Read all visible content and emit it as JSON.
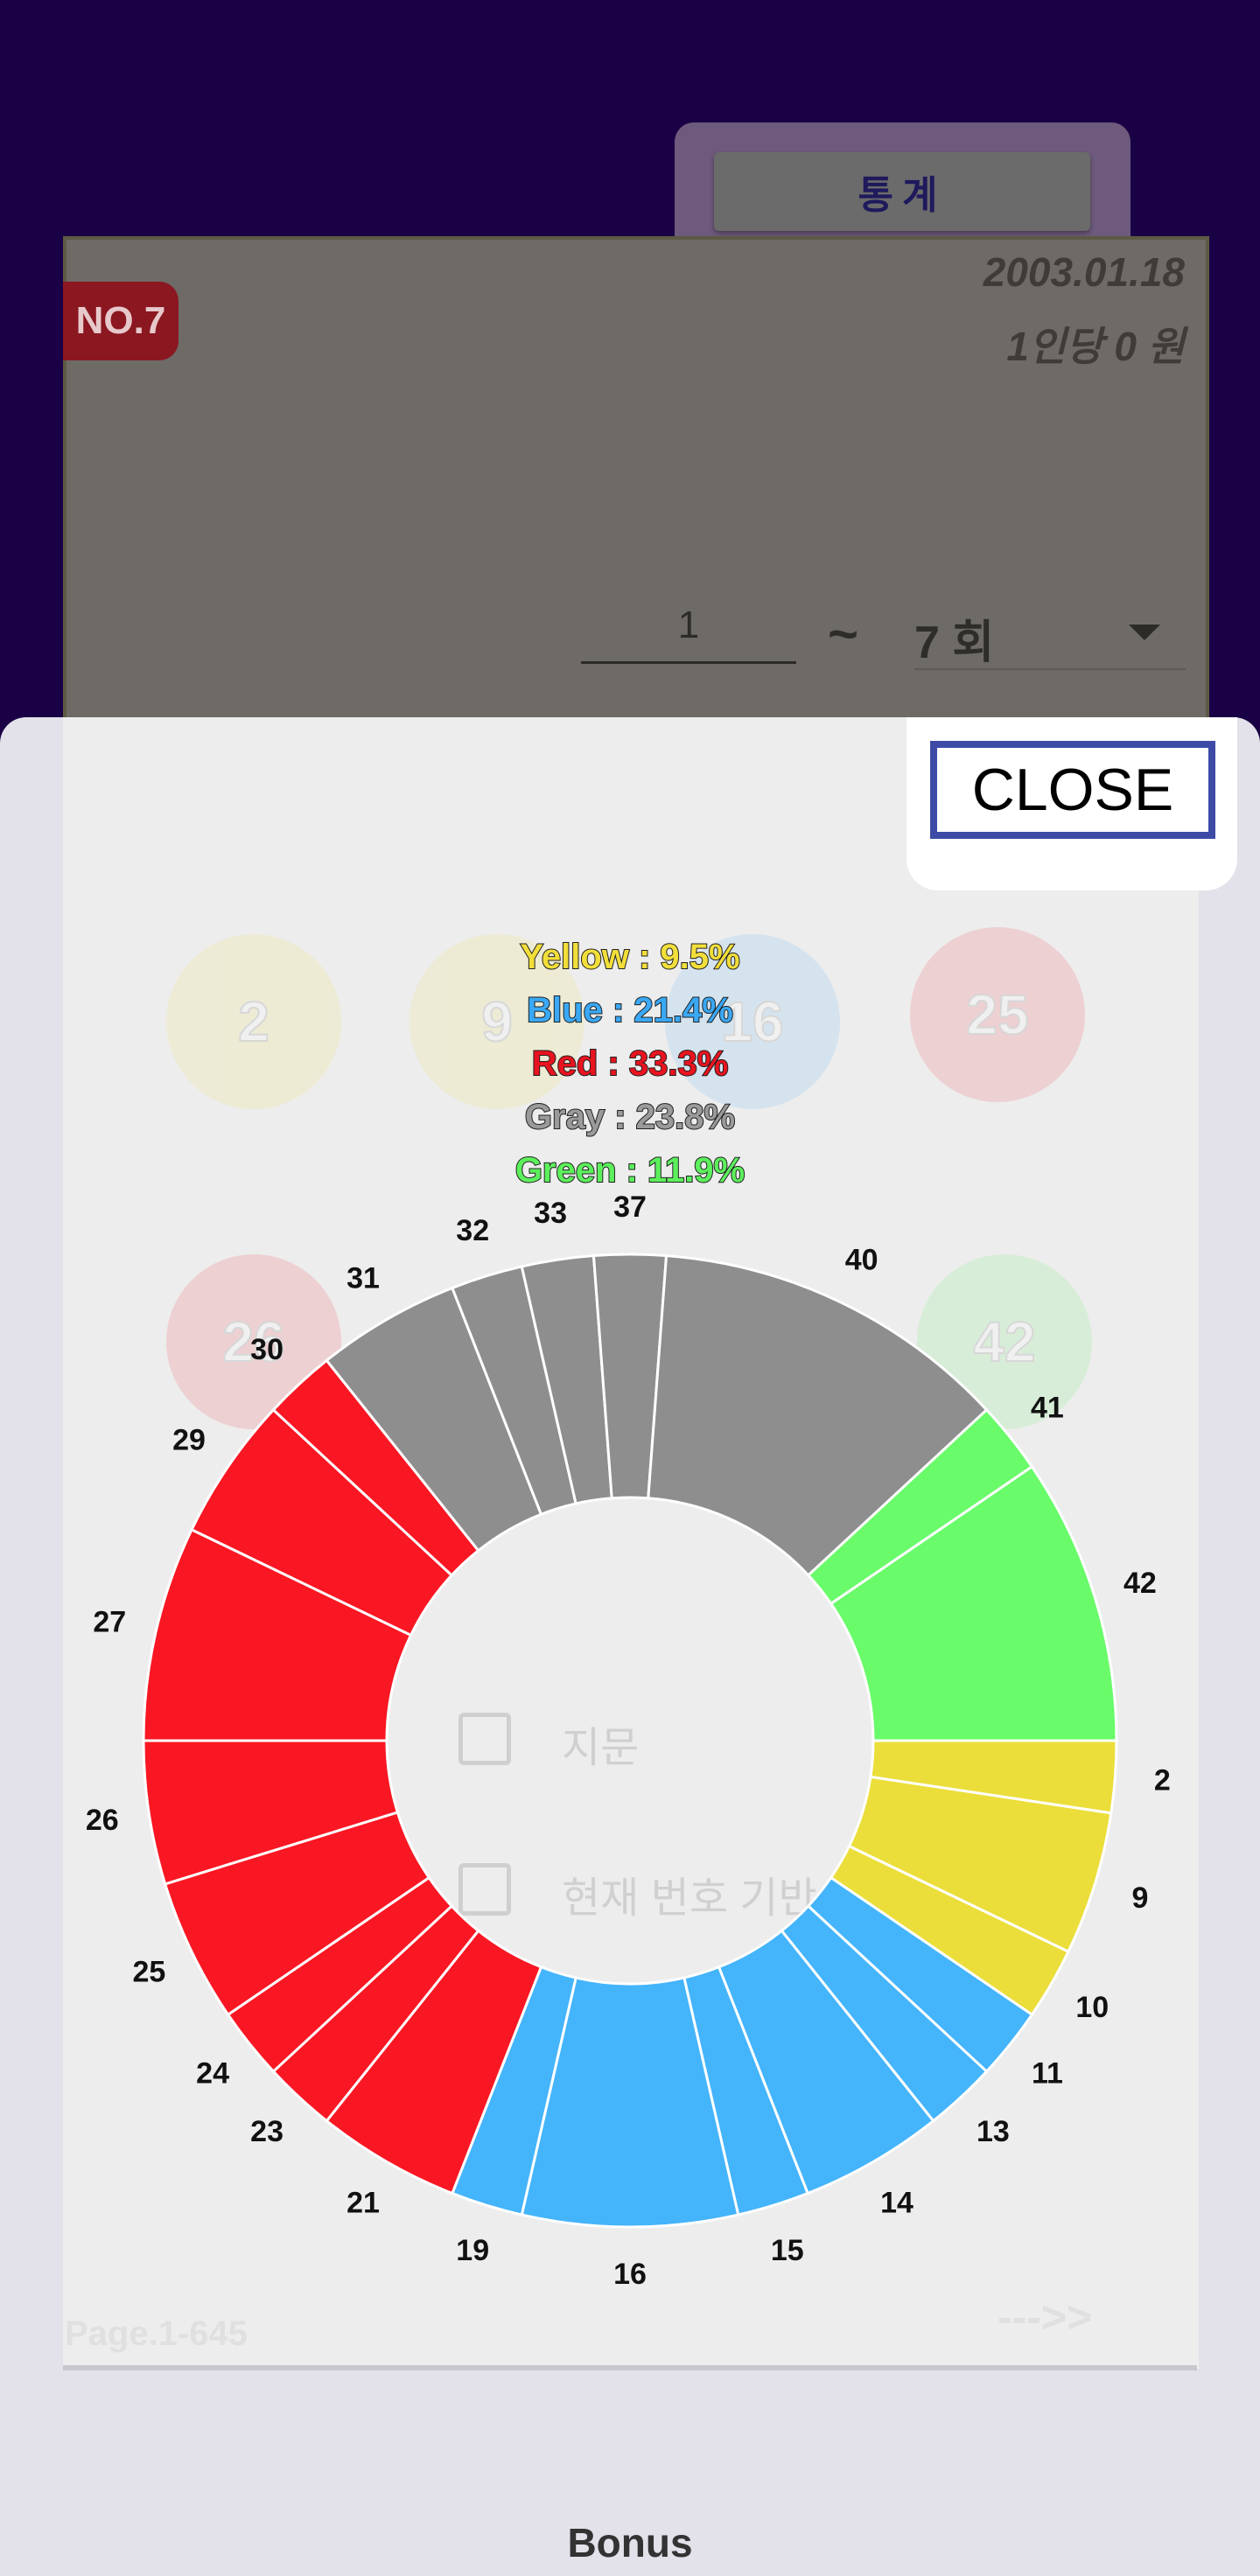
{
  "header": {
    "tab_label": "통계"
  },
  "draw": {
    "badge": "NO.7",
    "date": "2003.01.18",
    "prize": "1인당 0 원",
    "from_value": "1",
    "tilde": "~",
    "to_label": "7 회"
  },
  "modal": {
    "close_label": "CLOSE",
    "bonus_label": "Bonus",
    "ghost_options": [
      "지문",
      "현재 번호 기반"
    ],
    "ghost_page": "Page.1-645",
    "ghost_arrows": "--->>",
    "ghost_balls": [
      "2",
      "9",
      "16",
      "25",
      "26",
      "42"
    ]
  },
  "legend": {
    "yellow": "Yellow : 9.5%",
    "blue": "Blue : 21.4%",
    "red": "Red : 33.3%",
    "gray": "Gray : 23.8%",
    "green": "Green : 11.9%"
  },
  "colors": {
    "yellow": "#ebde3a",
    "blue": "#44b4fb",
    "red": "#f91723",
    "gray": "#8e8e8e",
    "green": "#69fb69",
    "legend_yellow": "#f2de3a",
    "legend_blue": "#3aa8f5",
    "legend_red": "#e8141f",
    "legend_gray": "#9a9a9a",
    "legend_green": "#5cf05c"
  },
  "chart_data": {
    "type": "pie",
    "style": "donut",
    "title": "",
    "slices": [
      {
        "label": "2",
        "value": 1,
        "group": "yellow"
      },
      {
        "label": "9",
        "value": 2,
        "group": "yellow"
      },
      {
        "label": "10",
        "value": 1,
        "group": "yellow"
      },
      {
        "label": "11",
        "value": 1,
        "group": "blue"
      },
      {
        "label": "13",
        "value": 1,
        "group": "blue"
      },
      {
        "label": "14",
        "value": 2,
        "group": "blue"
      },
      {
        "label": "15",
        "value": 1,
        "group": "blue"
      },
      {
        "label": "16",
        "value": 3,
        "group": "blue"
      },
      {
        "label": "19",
        "value": 1,
        "group": "blue"
      },
      {
        "label": "21",
        "value": 2,
        "group": "red"
      },
      {
        "label": "23",
        "value": 1,
        "group": "red"
      },
      {
        "label": "24",
        "value": 1,
        "group": "red"
      },
      {
        "label": "25",
        "value": 2,
        "group": "red"
      },
      {
        "label": "26",
        "value": 2,
        "group": "red"
      },
      {
        "label": "27",
        "value": 3,
        "group": "red"
      },
      {
        "label": "29",
        "value": 2,
        "group": "red"
      },
      {
        "label": "30",
        "value": 1,
        "group": "red"
      },
      {
        "label": "31",
        "value": 2,
        "group": "gray"
      },
      {
        "label": "32",
        "value": 1,
        "group": "gray"
      },
      {
        "label": "33",
        "value": 1,
        "group": "gray"
      },
      {
        "label": "37",
        "value": 1,
        "group": "gray"
      },
      {
        "label": "40",
        "value": 5,
        "group": "gray"
      },
      {
        "label": "41",
        "value": 1,
        "group": "green"
      },
      {
        "label": "42",
        "value": 4,
        "group": "green"
      }
    ]
  }
}
